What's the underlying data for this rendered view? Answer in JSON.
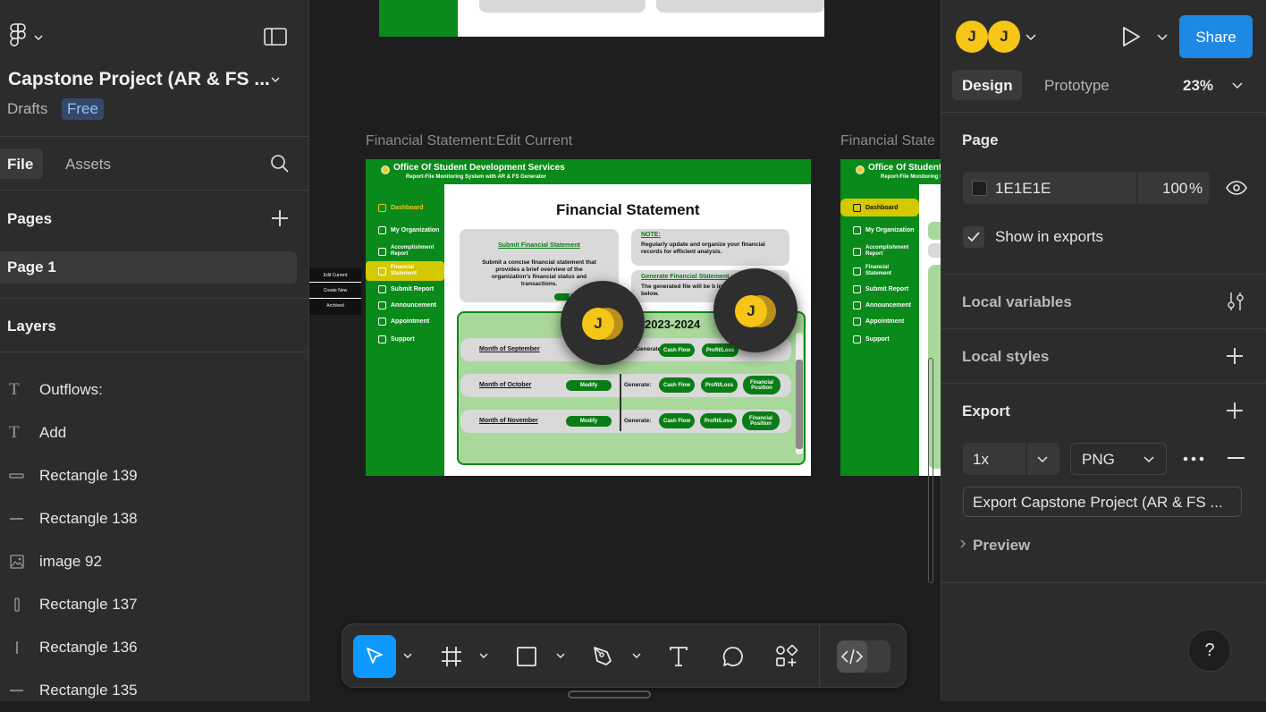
{
  "app": {
    "file_name": "Capstone Project (AR & FS ...",
    "location": "Drafts",
    "plan_badge": "Free"
  },
  "left_panel": {
    "tabs": [
      "File",
      "Assets"
    ],
    "pages_heading": "Pages",
    "pages": [
      "Page 1"
    ],
    "layers_heading": "Layers",
    "layers": [
      {
        "icon": "text",
        "name": "Outflows:"
      },
      {
        "icon": "text",
        "name": "Add"
      },
      {
        "icon": "rect-h",
        "name": "Rectangle 139"
      },
      {
        "icon": "line-h",
        "name": "Rectangle 138"
      },
      {
        "icon": "image",
        "name": "image 92"
      },
      {
        "icon": "rect-v",
        "name": "Rectangle 137"
      },
      {
        "icon": "line-v",
        "name": "Rectangle 136"
      },
      {
        "icon": "line-h",
        "name": "Rectangle 135"
      }
    ]
  },
  "canvas": {
    "frame1_label": "Financial Statement:Edit Current",
    "frame2_label": "Financial State",
    "side_menu": [
      "Edit Current",
      "Create New",
      "Archived"
    ],
    "design": {
      "org_title": "Office Of Student Development Services",
      "org_subtitle": "Report-File Monitoring System with AR & FS Generator",
      "nav": [
        "Dashboard",
        "My Organization",
        "Accomplishment Report",
        "Financial Statement",
        "Submit Report",
        "Announcement",
        "Appointment",
        "Support"
      ],
      "page_title": "Financial Statement",
      "submit_link": "Submit Financial Statement",
      "submit_desc": "Submit a concise financial statement that provides a brief overview of the organization's financial status and transactions.",
      "done_btn": "Done",
      "note_label": "NOTE:",
      "note_text": "Regularly update and organize your financial records for efficient analysis.",
      "generate_link": "Generate Financial Statement",
      "generate_text": "The generated file will be b info below.",
      "year": "2023-2024",
      "months": [
        "Month of September",
        "Month of October",
        "Month of November"
      ],
      "modify": "Modify",
      "generate_label": "Generate:",
      "gen_buttons": [
        "Cash Flow",
        "Profit/Loss",
        "Financial Position"
      ]
    },
    "collaborators": [
      "J",
      "J"
    ]
  },
  "toolbar": {
    "tools": [
      "move-tool",
      "frame-tool",
      "rectangle-tool",
      "pen-tool",
      "text-tool",
      "comment-tool",
      "actions-tool",
      "dev-mode-toggle"
    ]
  },
  "right_panel": {
    "avatars": [
      "J",
      "J"
    ],
    "share_label": "Share",
    "tabs": [
      "Design",
      "Prototype"
    ],
    "zoom": "23%",
    "page_heading": "Page",
    "bg_color": "1E1E1E",
    "bg_opacity": "100",
    "percent": "%",
    "show_in_exports": "Show in exports",
    "local_variables": "Local variables",
    "local_styles": "Local styles",
    "export_heading": "Export",
    "export_scale": "1x",
    "export_format": "PNG",
    "export_button": "Export Capstone Project (AR & FS ...",
    "preview_label": "Preview",
    "help": "?"
  },
  "colors": {
    "accent": "#0d99ff",
    "share_button": "#1e88e5",
    "avatar": "#f5c518",
    "design_green": "#0a8a1a"
  }
}
